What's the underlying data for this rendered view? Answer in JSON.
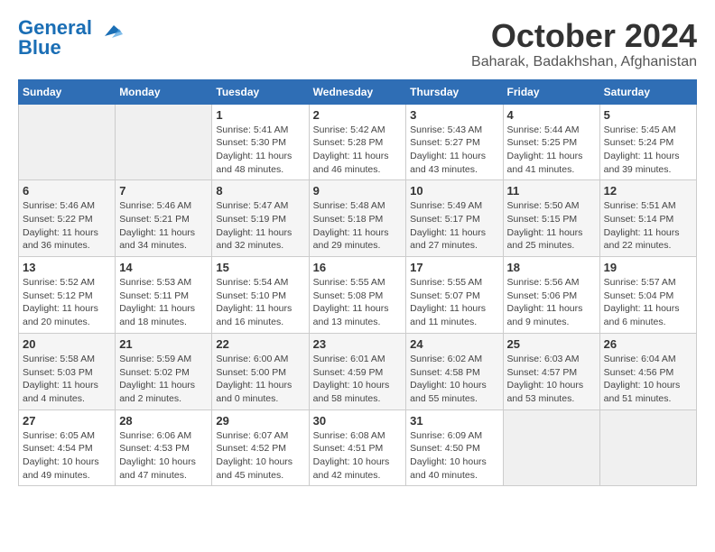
{
  "header": {
    "logo": {
      "line1": "General",
      "line2": "Blue"
    },
    "title": "October 2024",
    "location": "Baharak, Badakhshan, Afghanistan"
  },
  "weekdays": [
    "Sunday",
    "Monday",
    "Tuesday",
    "Wednesday",
    "Thursday",
    "Friday",
    "Saturday"
  ],
  "weeks": [
    [
      {
        "day": null,
        "detail": null
      },
      {
        "day": null,
        "detail": null
      },
      {
        "day": "1",
        "detail": "Sunrise: 5:41 AM\nSunset: 5:30 PM\nDaylight: 11 hours and 48 minutes."
      },
      {
        "day": "2",
        "detail": "Sunrise: 5:42 AM\nSunset: 5:28 PM\nDaylight: 11 hours and 46 minutes."
      },
      {
        "day": "3",
        "detail": "Sunrise: 5:43 AM\nSunset: 5:27 PM\nDaylight: 11 hours and 43 minutes."
      },
      {
        "day": "4",
        "detail": "Sunrise: 5:44 AM\nSunset: 5:25 PM\nDaylight: 11 hours and 41 minutes."
      },
      {
        "day": "5",
        "detail": "Sunrise: 5:45 AM\nSunset: 5:24 PM\nDaylight: 11 hours and 39 minutes."
      }
    ],
    [
      {
        "day": "6",
        "detail": "Sunrise: 5:46 AM\nSunset: 5:22 PM\nDaylight: 11 hours and 36 minutes."
      },
      {
        "day": "7",
        "detail": "Sunrise: 5:46 AM\nSunset: 5:21 PM\nDaylight: 11 hours and 34 minutes."
      },
      {
        "day": "8",
        "detail": "Sunrise: 5:47 AM\nSunset: 5:19 PM\nDaylight: 11 hours and 32 minutes."
      },
      {
        "day": "9",
        "detail": "Sunrise: 5:48 AM\nSunset: 5:18 PM\nDaylight: 11 hours and 29 minutes."
      },
      {
        "day": "10",
        "detail": "Sunrise: 5:49 AM\nSunset: 5:17 PM\nDaylight: 11 hours and 27 minutes."
      },
      {
        "day": "11",
        "detail": "Sunrise: 5:50 AM\nSunset: 5:15 PM\nDaylight: 11 hours and 25 minutes."
      },
      {
        "day": "12",
        "detail": "Sunrise: 5:51 AM\nSunset: 5:14 PM\nDaylight: 11 hours and 22 minutes."
      }
    ],
    [
      {
        "day": "13",
        "detail": "Sunrise: 5:52 AM\nSunset: 5:12 PM\nDaylight: 11 hours and 20 minutes."
      },
      {
        "day": "14",
        "detail": "Sunrise: 5:53 AM\nSunset: 5:11 PM\nDaylight: 11 hours and 18 minutes."
      },
      {
        "day": "15",
        "detail": "Sunrise: 5:54 AM\nSunset: 5:10 PM\nDaylight: 11 hours and 16 minutes."
      },
      {
        "day": "16",
        "detail": "Sunrise: 5:55 AM\nSunset: 5:08 PM\nDaylight: 11 hours and 13 minutes."
      },
      {
        "day": "17",
        "detail": "Sunrise: 5:55 AM\nSunset: 5:07 PM\nDaylight: 11 hours and 11 minutes."
      },
      {
        "day": "18",
        "detail": "Sunrise: 5:56 AM\nSunset: 5:06 PM\nDaylight: 11 hours and 9 minutes."
      },
      {
        "day": "19",
        "detail": "Sunrise: 5:57 AM\nSunset: 5:04 PM\nDaylight: 11 hours and 6 minutes."
      }
    ],
    [
      {
        "day": "20",
        "detail": "Sunrise: 5:58 AM\nSunset: 5:03 PM\nDaylight: 11 hours and 4 minutes."
      },
      {
        "day": "21",
        "detail": "Sunrise: 5:59 AM\nSunset: 5:02 PM\nDaylight: 11 hours and 2 minutes."
      },
      {
        "day": "22",
        "detail": "Sunrise: 6:00 AM\nSunset: 5:00 PM\nDaylight: 11 hours and 0 minutes."
      },
      {
        "day": "23",
        "detail": "Sunrise: 6:01 AM\nSunset: 4:59 PM\nDaylight: 10 hours and 58 minutes."
      },
      {
        "day": "24",
        "detail": "Sunrise: 6:02 AM\nSunset: 4:58 PM\nDaylight: 10 hours and 55 minutes."
      },
      {
        "day": "25",
        "detail": "Sunrise: 6:03 AM\nSunset: 4:57 PM\nDaylight: 10 hours and 53 minutes."
      },
      {
        "day": "26",
        "detail": "Sunrise: 6:04 AM\nSunset: 4:56 PM\nDaylight: 10 hours and 51 minutes."
      }
    ],
    [
      {
        "day": "27",
        "detail": "Sunrise: 6:05 AM\nSunset: 4:54 PM\nDaylight: 10 hours and 49 minutes."
      },
      {
        "day": "28",
        "detail": "Sunrise: 6:06 AM\nSunset: 4:53 PM\nDaylight: 10 hours and 47 minutes."
      },
      {
        "day": "29",
        "detail": "Sunrise: 6:07 AM\nSunset: 4:52 PM\nDaylight: 10 hours and 45 minutes."
      },
      {
        "day": "30",
        "detail": "Sunrise: 6:08 AM\nSunset: 4:51 PM\nDaylight: 10 hours and 42 minutes."
      },
      {
        "day": "31",
        "detail": "Sunrise: 6:09 AM\nSunset: 4:50 PM\nDaylight: 10 hours and 40 minutes."
      },
      {
        "day": null,
        "detail": null
      },
      {
        "day": null,
        "detail": null
      }
    ]
  ]
}
